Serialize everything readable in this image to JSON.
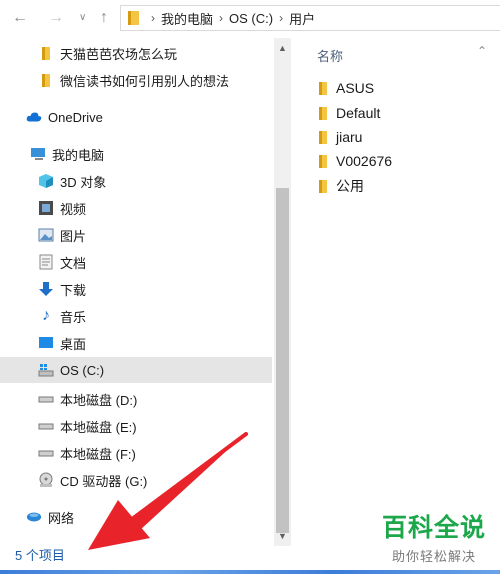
{
  "toolbar": {
    "back_icon": "back-arrow-icon",
    "forward_icon": "forward-arrow-icon",
    "expand_icon": "chevron-down-icon",
    "up_icon": "up-arrow-icon"
  },
  "breadcrumb": [
    "我的电脑",
    "OS (C:)",
    "用户"
  ],
  "nav": {
    "items": [
      {
        "label": "天猫芭芭农场怎么玩",
        "icon": "folder-icon"
      },
      {
        "label": "微信读书如何引用别人的想法",
        "icon": "folder-icon"
      },
      {
        "label": "OneDrive",
        "icon": "cloud-icon"
      },
      {
        "label": "我的电脑",
        "icon": "computer-icon"
      },
      {
        "label": "3D 对象",
        "icon": "3d-objects-icon"
      },
      {
        "label": "视频",
        "icon": "video-icon"
      },
      {
        "label": "图片",
        "icon": "pictures-icon"
      },
      {
        "label": "文档",
        "icon": "document-icon"
      },
      {
        "label": "下载",
        "icon": "download-icon"
      },
      {
        "label": "音乐",
        "icon": "music-icon"
      },
      {
        "label": "桌面",
        "icon": "desktop-icon"
      },
      {
        "label": "OS (C:)",
        "icon": "windows-drive-icon"
      },
      {
        "label": "本地磁盘 (D:)",
        "icon": "drive-icon"
      },
      {
        "label": "本地磁盘 (E:)",
        "icon": "drive-icon"
      },
      {
        "label": "本地磁盘 (F:)",
        "icon": "drive-icon"
      },
      {
        "label": "CD 驱动器 (G:)",
        "icon": "cd-drive-icon"
      },
      {
        "label": "网络",
        "icon": "network-icon"
      }
    ]
  },
  "files": {
    "column_header": "名称",
    "sort_icon": "sort-up-icon",
    "items": [
      "ASUS",
      "Default",
      "jiaru",
      "V002676",
      "公用"
    ]
  },
  "status": {
    "item_count": "5 个项目"
  },
  "watermark": {
    "main": "百科全说",
    "sub": "助你轻松解决"
  },
  "colors": {
    "accent": "#1a5aa8",
    "folder": "#f4c542",
    "watermark": "#1ca74b",
    "arrow": "#e8232a",
    "selected": "#e5e5e5"
  }
}
